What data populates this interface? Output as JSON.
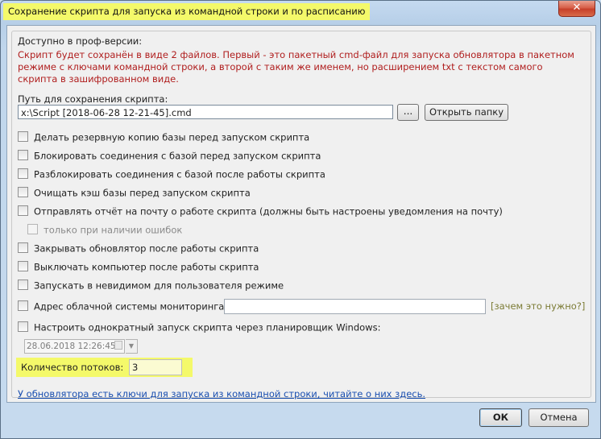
{
  "window": {
    "title": "Сохранение скрипта для запуска из командной строки и по расписанию",
    "close_glyph": "✕"
  },
  "group": {
    "title": "Доступно в проф-версии:",
    "description": "Скрипт будет сохранён в виде 2 файлов. Первый - это пакетный cmd-файл для запуска обновлятора в пакетном режиме с ключами командной строки, а второй с таким же именем, но расширением txt с текстом самого скрипта в зашифрованном виде."
  },
  "path": {
    "label": "Путь для сохранения скрипта:",
    "value": "x:\\Script [2018-06-28 12-21-45].cmd",
    "browse_label": "...",
    "open_folder_label": "Открыть папку"
  },
  "options": {
    "backup": "Делать резервную копию базы перед запуском скрипта",
    "block": "Блокировать соединения с базой перед запуском скрипта",
    "unblock": "Разблокировать соединения с базой после работы скрипта",
    "clear_cache": "Очищать кэш базы перед запуском скрипта",
    "send_report": "Отправлять отчёт на почту о работе скрипта (должны быть настроены уведомления на почту)",
    "only_errors": "только при наличии ошибок",
    "close_updater": "Закрывать обновлятор после работы скрипта",
    "shutdown": "Выключать компьютер после работы скрипта",
    "invisible": "Запускать в невидимом для пользователя режиме",
    "cloud_address": "Адрес облачной системы мониторинга",
    "scheduler": "Настроить однократный запуск скрипта через планировщик Windows:"
  },
  "cloud": {
    "value": "",
    "why_link": "[зачем это нужно?]"
  },
  "schedule": {
    "datetime": "28.06.2018 12:26:45",
    "dropdown_glyph": "▼"
  },
  "threads": {
    "label": "Количество потоков:",
    "value": "3"
  },
  "info_link": "У обновлятора есть ключи для запуска из командной строки, читайте о них здесь.",
  "buttons": {
    "ok": "ОК",
    "cancel": "Отмена"
  },
  "colors": {
    "highlight": "#f4f96a",
    "description_text": "#b01e1e",
    "link": "#1a4fb0"
  }
}
